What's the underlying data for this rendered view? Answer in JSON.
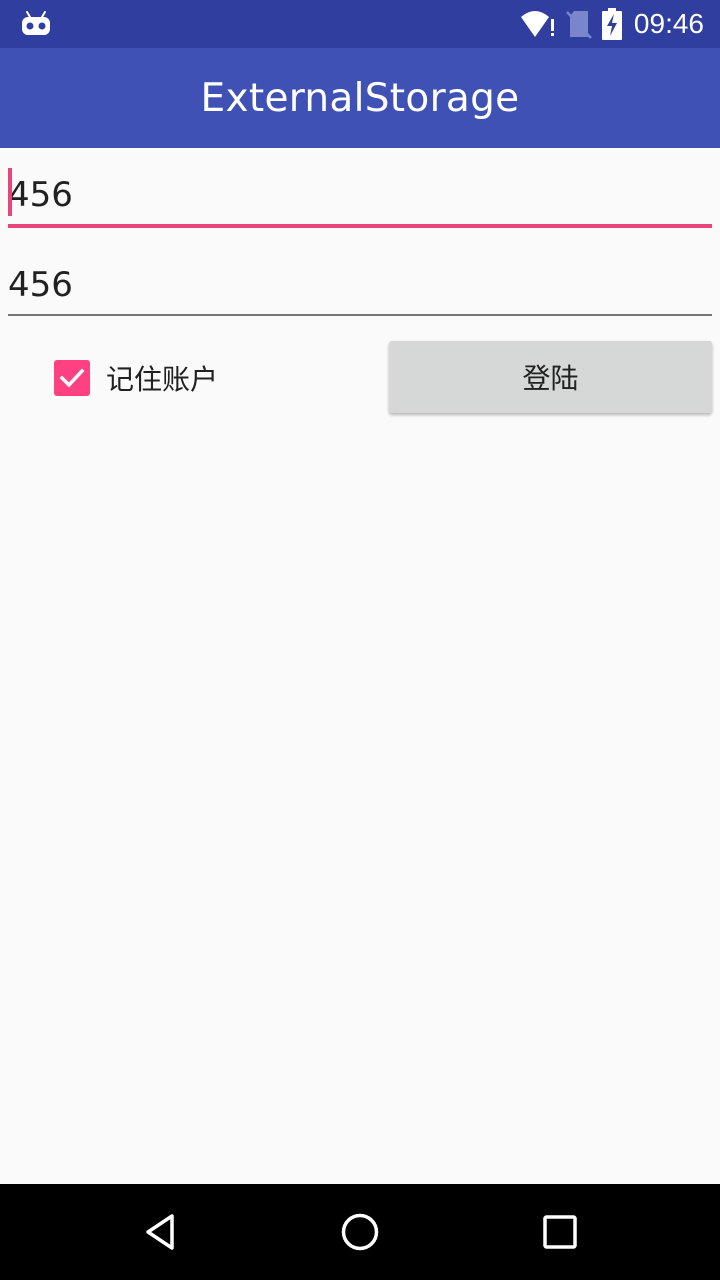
{
  "status_bar": {
    "time": "09:46",
    "icons": [
      "android-debug-icon",
      "wifi-alert-icon",
      "no-sim-icon",
      "battery-charging-icon"
    ]
  },
  "app_bar": {
    "title": "ExternalStorage"
  },
  "form": {
    "account_value": "456",
    "password_value": "456",
    "remember_label": "记住账户",
    "remember_checked": true,
    "login_label": "登陆"
  },
  "nav_bar": {
    "icons": [
      "back-icon",
      "home-icon",
      "recents-icon"
    ]
  },
  "colors": {
    "status_bar": "#303f9f",
    "app_bar": "#3f51b5",
    "accent": "#ff4081",
    "background": "#fafafa",
    "button": "#d6d7d7"
  }
}
